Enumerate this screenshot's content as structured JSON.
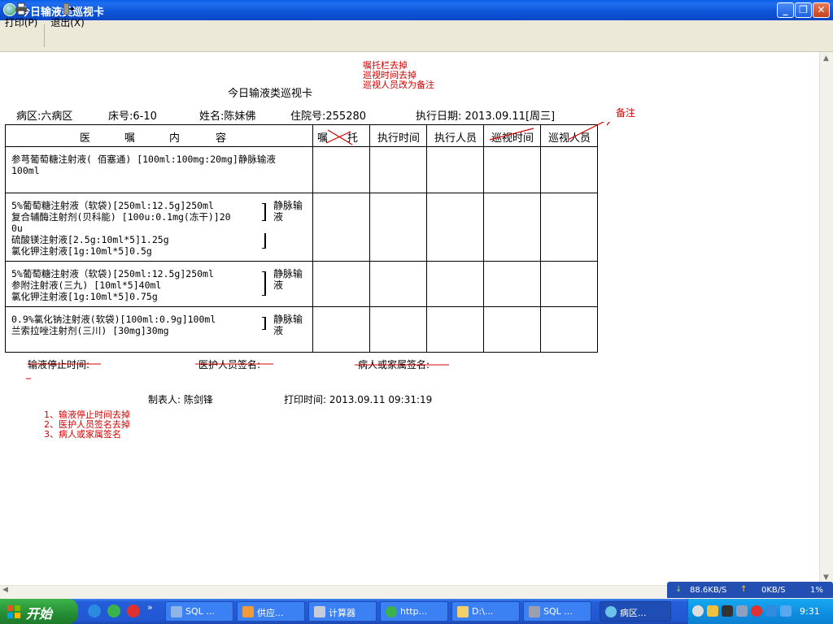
{
  "window": {
    "title": "今日输液类巡视卡"
  },
  "toolbar": {
    "print_label": "打印(P)",
    "exit_label": "退出(X)"
  },
  "notes": {
    "top": [
      "嘱托栏去掉",
      "巡视时间去掉",
      "巡视人员改为备注"
    ],
    "right": "备注",
    "bottom": [
      "1、输液停止时间去掉",
      "2、医护人员签名去掉",
      "3、病人或家属签名"
    ]
  },
  "card": {
    "title": "今日输液类巡视卡",
    "ward": "病区:六病区",
    "bed": "床号:6-10",
    "name": "姓名:陈妹佛",
    "admission": "住院号:255280",
    "exec_date": "执行日期: 2013.09.11[周三]",
    "columns": [
      "医",
      "嘱",
      "内",
      "容",
      "嘱",
      "托",
      "执行时间",
      "执行人员",
      "巡视时间",
      "巡视人员"
    ],
    "rows": [
      {
        "text": "参芎葡萄糖注射液( 佰塞通) [100ml:100mg:20mg]静脉输液\n100ml",
        "route": ""
      },
      {
        "text": "5%葡萄糖注射液（软袋)[250ml:12.5g]250ml\n复合辅酶注射剂(贝科能) [100u:0.1mg(冻干)]20\n0u\n硫酸镁注射液[2.5g:10ml*5]1.25g\n氯化钾注射液[1g:10ml*5]0.5g",
        "route": "静脉输\n液"
      },
      {
        "text": "5%葡萄糖注射液（软袋)[250ml:12.5g]250ml\n参附注射液(三九) [10ml*5]40ml\n氯化钾注射液[1g:10ml*5]0.75g",
        "route": "静脉输\n液"
      },
      {
        "text": "0.9%氯化钠注射液(软袋)[100ml:0.9g]100ml\n兰索拉唑注射剂(三川) [30mg]30mg",
        "route": "静脉输\n液"
      }
    ],
    "footer": {
      "stop_time": "输液停止时间:",
      "staff_sign": "医护人员签名:",
      "patient_sign": "病人或家属签名:"
    },
    "maker": "制表人: 陈剑锋",
    "print_time": "打印时间: 2013.09.11    09:31:19"
  },
  "speed": {
    "down": "88.6KB/S",
    "up": "0KB/S",
    "pct": "1%"
  },
  "taskbar": {
    "start_label": "开始",
    "tasks": [
      "SQL ...",
      "供应...",
      "计算器",
      "http...",
      "D:\\...",
      "SQL ...",
      "病区..."
    ],
    "clock": "9:31"
  },
  "colors": {
    "annotation": "#d40000",
    "titlebar": "#0a5fe8",
    "taskbar": "#245edb",
    "start": "#3db44a"
  }
}
